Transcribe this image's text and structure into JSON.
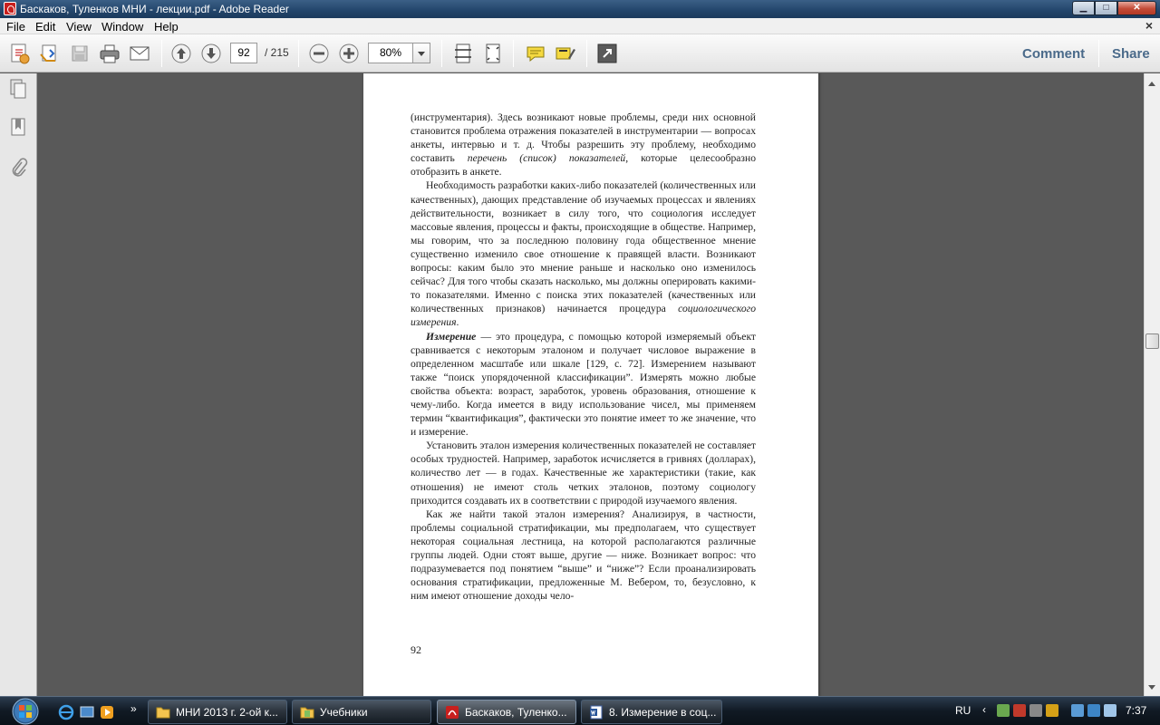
{
  "window": {
    "title": "Баскаков, Туленков МНИ - лекции.pdf - Adobe Reader",
    "buttons": {
      "minimize": "▁",
      "maximize": "□",
      "close": "✕"
    }
  },
  "menu": {
    "items": [
      "File",
      "Edit",
      "View",
      "Window",
      "Help"
    ],
    "doc_close": "×"
  },
  "toolbar": {
    "page_current": "92",
    "page_total": "/ 215",
    "zoom": "80%",
    "comment_label": "Comment",
    "share_label": "Share",
    "icons": [
      "create-pdf-icon",
      "open-icon",
      "save-icon",
      "print-icon",
      "email-icon",
      "prev-page-icon",
      "next-page-icon",
      "zoom-out-icon",
      "zoom-in-icon",
      "fit-width-icon",
      "fit-page-icon",
      "sticky-note-icon",
      "highlight-icon",
      "fullscreen-icon"
    ]
  },
  "navpanel": {
    "icons": [
      "pages-icon",
      "bookmarks-icon",
      "attachments-icon"
    ]
  },
  "document": {
    "paragraphs": [
      {
        "parts": [
          {
            "t": "(инструментария). Здесь возникают новые проблемы, среди них основной становится проблема отражения показателей в инструментарии — вопросах анкеты, интервью и т. д. Чтобы разрешить эту проблему, необходимо составить "
          },
          {
            "t": "перечень (список) показателей",
            "i": true
          },
          {
            "t": ", которые целесообразно отобразить в анкете."
          }
        ]
      },
      {
        "parts": [
          {
            "t": "Необходимость разработки каких-либо показателей (количественных или качественных), дающих представление об изучаемых процессах и явлениях действительности, возникает в силу того, что социология исследует массовые явления, процессы и факты, происходящие в обществе. Например, мы говорим, что за последнюю половину года общественное мнение существенно изменило свое отношение к правящей власти. Возникают вопросы: каким было это мнение раньше и насколько оно изменилось сейчас? Для того чтобы сказать насколько, мы должны оперировать какими-то показателями. Именно с поиска этих показателей (качественных или количественных признаков) начинается процедура "
          },
          {
            "t": "социологического измерения",
            "i": true
          },
          {
            "t": "."
          }
        ]
      },
      {
        "parts": [
          {
            "t": "Измерение",
            "i": true,
            "b": true
          },
          {
            "t": " — это процедура, с помощью которой измеряемый объект сравнивается с некоторым эталоном и получает числовое выражение в определенном масштабе или шкале [129, с. 72]. Измерением называют также “поиск упорядоченной классификации”. Измерять можно любые свойства объекта: возраст, заработок, уровень образования, отношение к чему-либо. Когда имеется в виду использование чисел, мы применяем термин “квантификация”, фактически это понятие имеет то же значение, что и измерение."
          }
        ]
      },
      {
        "parts": [
          {
            "t": "Установить эталон измерения количественных показателей не составляет особых трудностей. Например, заработок исчисляется в гривнях (долларах), количество лет — в годах. Качественные же характеристики (такие, как отношения) не имеют столь четких эталонов, поэтому социологу приходится создавать их в соответствии с природой изучаемого явления."
          }
        ]
      },
      {
        "parts": [
          {
            "t": "Как же найти такой эталон измерения? Анализируя, в частности, проблемы социальной стратификации, мы предполагаем, что существует некоторая социальная лестница, на которой располагаются различные группы людей. Одни стоят выше, другие — ниже. Возникает вопрос: что подразумевается под понятием “выше” и “ниже”? Если проанализировать основания стратификации, предложенные М. Вебером, то, безусловно, к ним имеют отношение доходы чело-"
          }
        ]
      }
    ],
    "page_number": "92"
  },
  "taskbar": {
    "tasks": [
      {
        "label": "МНИ 2013 г. 2-ой к...",
        "icon": "folder-icon"
      },
      {
        "label": "Учебники",
        "icon": "folder-icon"
      },
      {
        "label": "Баскаков, Туленко...",
        "icon": "pdf-icon"
      },
      {
        "label": "8. Измерение в соц...",
        "icon": "word-icon"
      }
    ],
    "language": "RU",
    "clock": "7:37"
  }
}
